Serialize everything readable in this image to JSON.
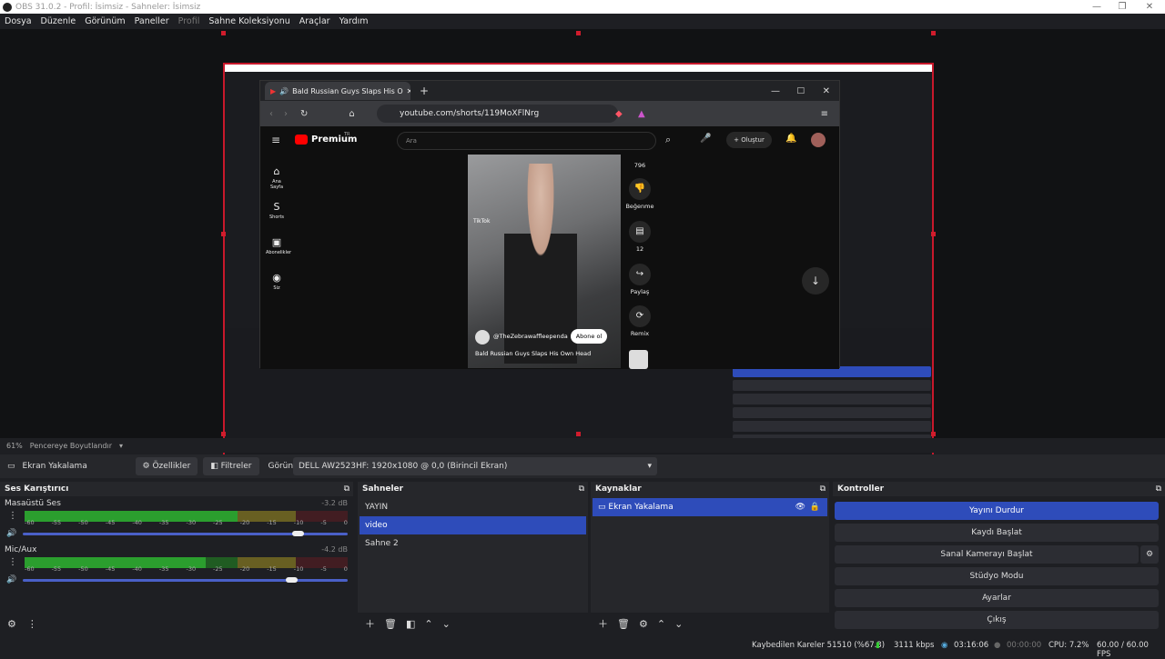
{
  "window": {
    "title": "OBS 31.0.2 - Profil: İsimsiz - Sahneler: İsimsiz"
  },
  "menu": [
    "Dosya",
    "Düzenle",
    "Görünüm",
    "Paneller",
    "Profil",
    "Sahne Koleksiyonu",
    "Araçlar",
    "Yardım"
  ],
  "browser": {
    "tab_title": "Bald Russian Guys Slaps His O",
    "url": "youtube.com/shorts/119MoXFlNrg",
    "yt_logo": "Premium",
    "yt_region": "TR",
    "search_placeholder": "Ara",
    "create_label": "Oluştur",
    "sidebar": [
      "Ana Sayfa",
      "Shorts",
      "Abonelikler",
      "Siz"
    ],
    "likes": "796",
    "dislike_label": "Beğenme",
    "comments": "12",
    "share_label": "Paylaş",
    "remix_label": "Remix",
    "channel": "@TheZebrawaffleependa",
    "subscribe_label": "Abone ol",
    "video_title": "Bald Russian Guys Slaps His Own Head",
    "watermark": "TikTok"
  },
  "preview_bar": {
    "zoom": "61%",
    "mode": "Pencereye Boyutlandır"
  },
  "source_toolbar": {
    "source_name": "Ekran Yakalama",
    "properties_label": "Özellikler",
    "filters_label": "Filtreler",
    "display_label": "Görüntü",
    "display_value": "DELL AW2523HF: 1920x1080 @ 0,0 (Birincil Ekran)"
  },
  "mixer": {
    "title": "Ses Karıştırıcı",
    "channels": [
      {
        "name": "Masaüstü Ses",
        "db": "-3.2 dB",
        "level": 0.66,
        "volume": 0.83
      },
      {
        "name": "Mic/Aux",
        "db": "-4.2 dB",
        "level": 0.56,
        "volume": 0.81
      }
    ],
    "ticks": [
      "-60",
      "-55",
      "-50",
      "-45",
      "-40",
      "-35",
      "-30",
      "-25",
      "-20",
      "-15",
      "-10",
      "-5",
      "0"
    ]
  },
  "scenes": {
    "title": "Sahneler",
    "items": [
      "YAYIN",
      "video",
      "Sahne 2"
    ],
    "selected": "video"
  },
  "sources": {
    "title": "Kaynaklar",
    "items": [
      "Ekran Yakalama"
    ]
  },
  "controls": {
    "title": "Kontroller",
    "buttons": [
      "Yayını Durdur",
      "Kaydı Başlat",
      "Sanal Kamerayı Başlat",
      "Stüdyo Modu",
      "Ayarlar",
      "Çıkış"
    ]
  },
  "status": {
    "dropped": "Kaybedilen Kareler 51510 (%67.3)",
    "bitrate": "3111 kbps",
    "stream_time": "03:16:06",
    "rec_time": "00:00:00",
    "cpu": "CPU: 7.2%",
    "fps": "60.00 / 60.00 FPS"
  },
  "colors": {
    "accent": "#2e4cba",
    "selection": "#c8182b"
  }
}
